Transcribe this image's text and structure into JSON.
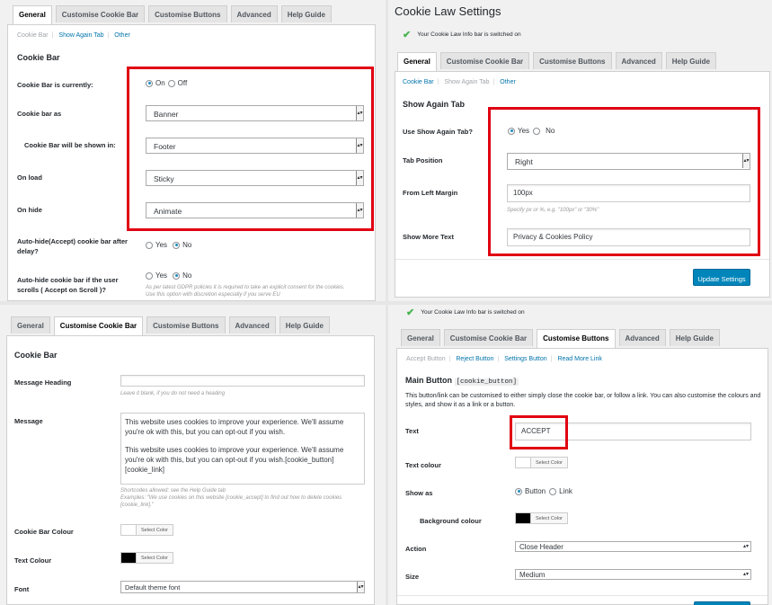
{
  "p1": {
    "tabs": [
      "General",
      "Customise Cookie Bar",
      "Customise Buttons",
      "Advanced",
      "Help Guide"
    ],
    "sublinks": [
      "Cookie Bar",
      "Show Again Tab",
      "Other"
    ],
    "heading": "Cookie Bar",
    "bar_currently_label": "Cookie Bar is currently:",
    "on": "On",
    "off": "Off",
    "bar_as_label": "Cookie bar as",
    "bar_as_value": "Banner",
    "shown_in_label": "Cookie Bar will be shown in:",
    "shown_in_value": "Footer",
    "on_load_label": "On load",
    "on_load_value": "Sticky",
    "on_hide_label": "On hide",
    "on_hide_value": "Animate",
    "autohide_label": "Auto-hide(Accept) cookie bar after delay?",
    "autohide_scroll_label": "Auto-hide cookie bar if the user scrolls ( Accept on Scroll )?",
    "yes": "Yes",
    "no": "No",
    "scroll_hint": "As per latest GDPR policies it is required to take an explicit consent for the cookies. Use this option with discretion especially if you serve EU"
  },
  "p2": {
    "title": "Cookie Law Settings",
    "notice": "Your Cookie Law Info bar is switched on",
    "tabs": [
      "General",
      "Customise Cookie Bar",
      "Customise Buttons",
      "Advanced",
      "Help Guide"
    ],
    "sublinks": [
      "Cookie Bar",
      "Show Again Tab",
      "Other"
    ],
    "heading": "Show Again Tab",
    "use_label": "Use Show Again Tab?",
    "yes": "Yes",
    "no": "No",
    "tab_pos_label": "Tab Position",
    "tab_pos_value": "Right",
    "margin_label": "From Left Margin",
    "margin_value": "100px",
    "margin_hint": "Specify px or %, e.g. \"100px\" or \"30%\"",
    "more_text_label": "Show More Text",
    "more_text_value": "Privacy & Cookies Policy",
    "update_button": "Update Settings"
  },
  "p3": {
    "tabs": [
      "General",
      "Customise Cookie Bar",
      "Customise Buttons",
      "Advanced",
      "Help Guide"
    ],
    "heading": "Cookie Bar",
    "msg_heading_label": "Message Heading",
    "msg_heading_hint": "Leave it blank, if you do not need a heading",
    "message_label": "Message",
    "message_p1": "This website uses cookies to improve your experience. We'll assume you're ok with this, but you can opt-out if you wish.",
    "message_p2": "This website uses cookies to improve your experience. We'll assume you're ok with this, but you can opt-out if you wish.[cookie_button] [cookie_link]",
    "message_hint1": "Shortcodes allowed: see the Help Guide tab",
    "message_hint2": "Examples: \"We use cookies on this website [cookie_accept] to find out how to delete cookies [cookie_link].\"",
    "bar_colour_label": "Cookie Bar Colour",
    "text_colour_label": "Text Colour",
    "select_color": "Select Color",
    "font_label": "Font",
    "font_value": "Default theme font"
  },
  "p4": {
    "notice": "Your Cookie Law Info bar is switched on",
    "tabs": [
      "General",
      "Customise Cookie Bar",
      "Customise Buttons",
      "Advanced",
      "Help Guide"
    ],
    "sublinks": [
      "Accept Button",
      "Reject Button",
      "Settings Button",
      "Read More Link"
    ],
    "heading": "Main Button",
    "heading_code": "[cookie_button]",
    "desc": "This button/link can be customised to either simply close the cookie bar, or follow a link. You can also customise the colours and styles, and show it as a link or a button.",
    "text_label": "Text",
    "text_value": "ACCEPT",
    "text_colour_label": "Text colour",
    "select_color": "Select Color",
    "show_as_label": "Show as",
    "button": "Button",
    "link": "Link",
    "bg_colour_label": "Background colour",
    "action_label": "Action",
    "action_value": "Close Header",
    "size_label": "Size",
    "size_value": "Medium"
  },
  "colors": {
    "highlight": "#e00012",
    "accent": "#0085ba",
    "link": "#0073aa",
    "notice_check": "#46b450"
  }
}
